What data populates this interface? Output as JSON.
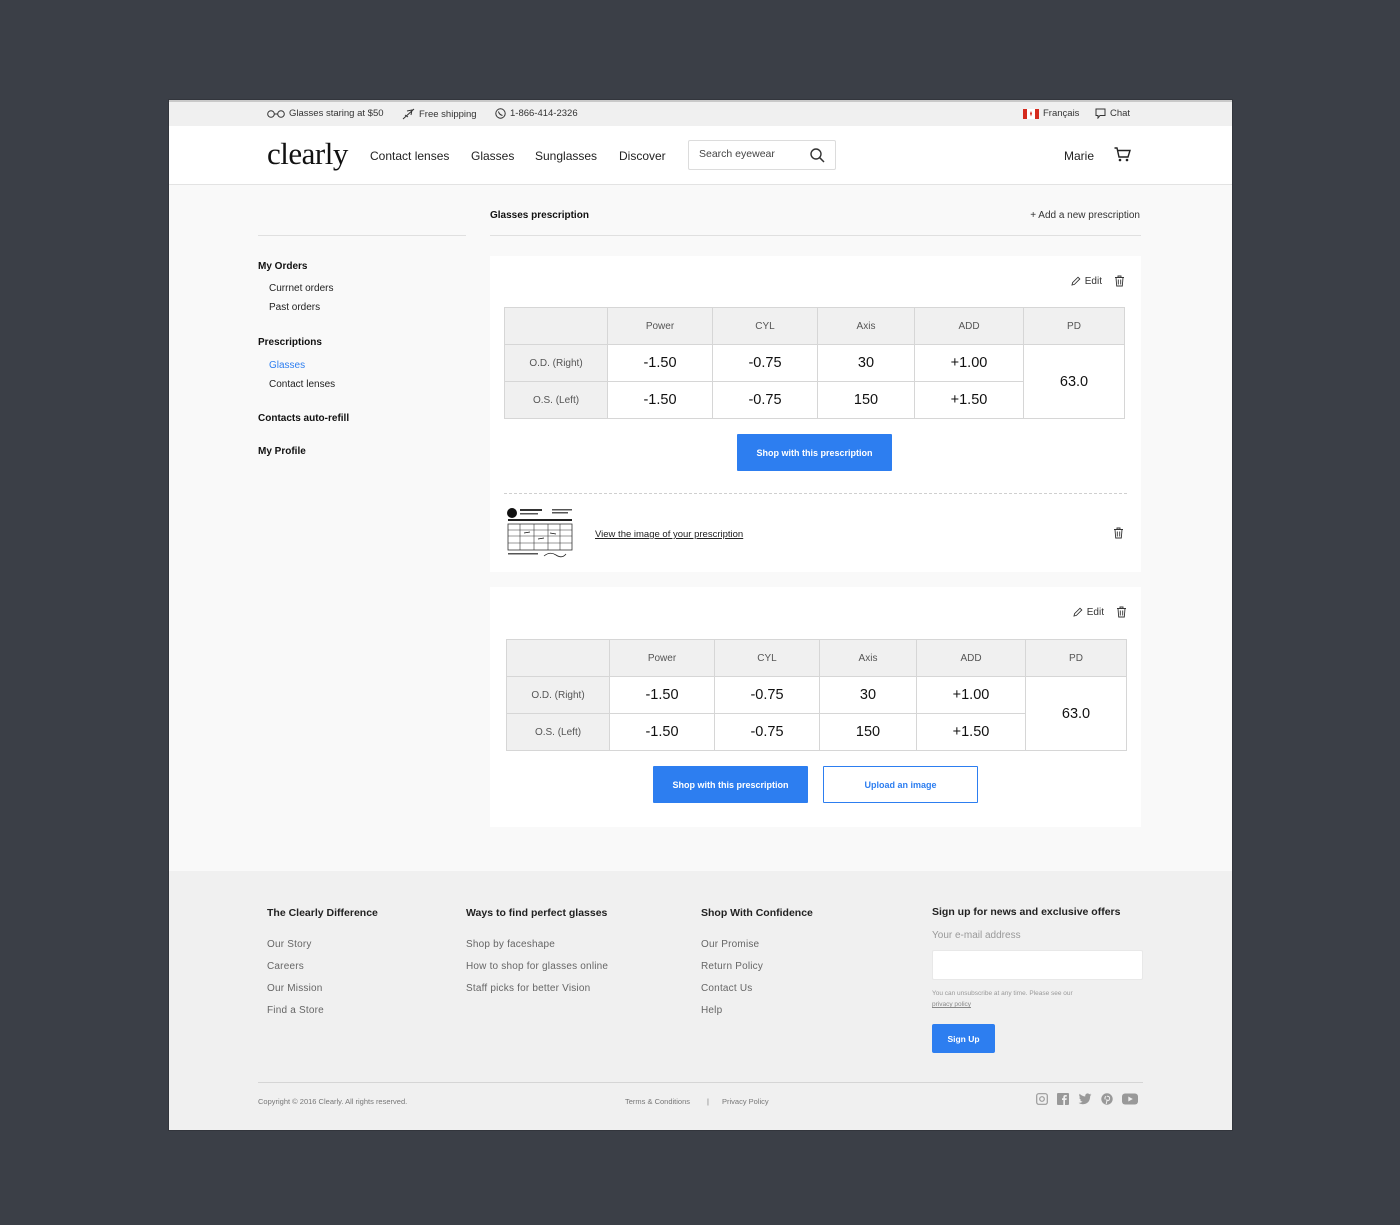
{
  "topbar": {
    "promo": "Glasses staring at $50",
    "shipping": "Free shipping",
    "phone": "1-866-414-2326",
    "language": "Français",
    "chat": "Chat"
  },
  "header": {
    "logo": "clearly",
    "nav": [
      "Contact lenses",
      "Glasses",
      "Sunglasses",
      "Discover"
    ],
    "search_placeholder": "Search eyewear",
    "user": "Marie"
  },
  "sidebar": {
    "sections": [
      {
        "title": "My Orders",
        "links": [
          "Currnet orders",
          "Past orders"
        ]
      },
      {
        "title": "Prescriptions",
        "links": [
          "Glasses",
          "Contact lenses"
        ],
        "active": "Glasses"
      },
      {
        "title": "Contacts auto-refill",
        "links": []
      },
      {
        "title": "My Profile",
        "links": []
      }
    ]
  },
  "main": {
    "title": "Glasses prescription",
    "add_label": "+ Add a new prescription",
    "edit_label": "Edit",
    "columns": [
      "Power",
      "CYL",
      "Axis",
      "ADD",
      "PD"
    ],
    "prescriptions": [
      {
        "rows": [
          {
            "label": "O.D. (Right)",
            "values": [
              "-1.50",
              "-0.75",
              "30",
              "+1.00"
            ]
          },
          {
            "label": "O.S. (Left)",
            "values": [
              "-1.50",
              "-0.75",
              "150",
              "+1.50"
            ]
          }
        ],
        "pd": "63.0",
        "shop_label": "Shop with this prescription",
        "image_link": "View the image of your prescription"
      },
      {
        "rows": [
          {
            "label": "O.D. (Right)",
            "values": [
              "-1.50",
              "-0.75",
              "30",
              "+1.00"
            ]
          },
          {
            "label": "O.S. (Left)",
            "values": [
              "-1.50",
              "-0.75",
              "150",
              "+1.50"
            ]
          }
        ],
        "pd": "63.0",
        "shop_label": "Shop with this prescription",
        "upload_label": "Upload an image"
      }
    ]
  },
  "footer": {
    "columns": [
      {
        "title": "The Clearly Difference",
        "links": [
          "Our Story",
          "Careers",
          "Our Mission",
          "Find a Store"
        ]
      },
      {
        "title": "Ways to find perfect glasses",
        "links": [
          "Shop by faceshape",
          "How to shop for glasses online",
          "Staff picks for better Vision"
        ]
      },
      {
        "title": "Shop With Confidence",
        "links": [
          "Our Promise",
          "Return Policy",
          "Contact Us",
          "Help"
        ]
      }
    ],
    "signup_title": "Sign up for news and exclusive offers",
    "email_label": "Your e-mail address",
    "fine_print": "You can unsubscribe at any time. Please see our",
    "privacy_link": "privacy policy",
    "signup_button": "Sign Up",
    "copyright": "Copyright © 2016 Clearly. All rights reserved.",
    "terms": "Terms & Conditions",
    "separator": "|",
    "privacy": "Privacy Policy",
    "social": [
      "instagram-icon",
      "facebook-icon",
      "twitter-icon",
      "pinterest-icon",
      "youtube-icon"
    ]
  },
  "colors": {
    "accent": "#2d7ef0",
    "background": "#3b3f47"
  }
}
